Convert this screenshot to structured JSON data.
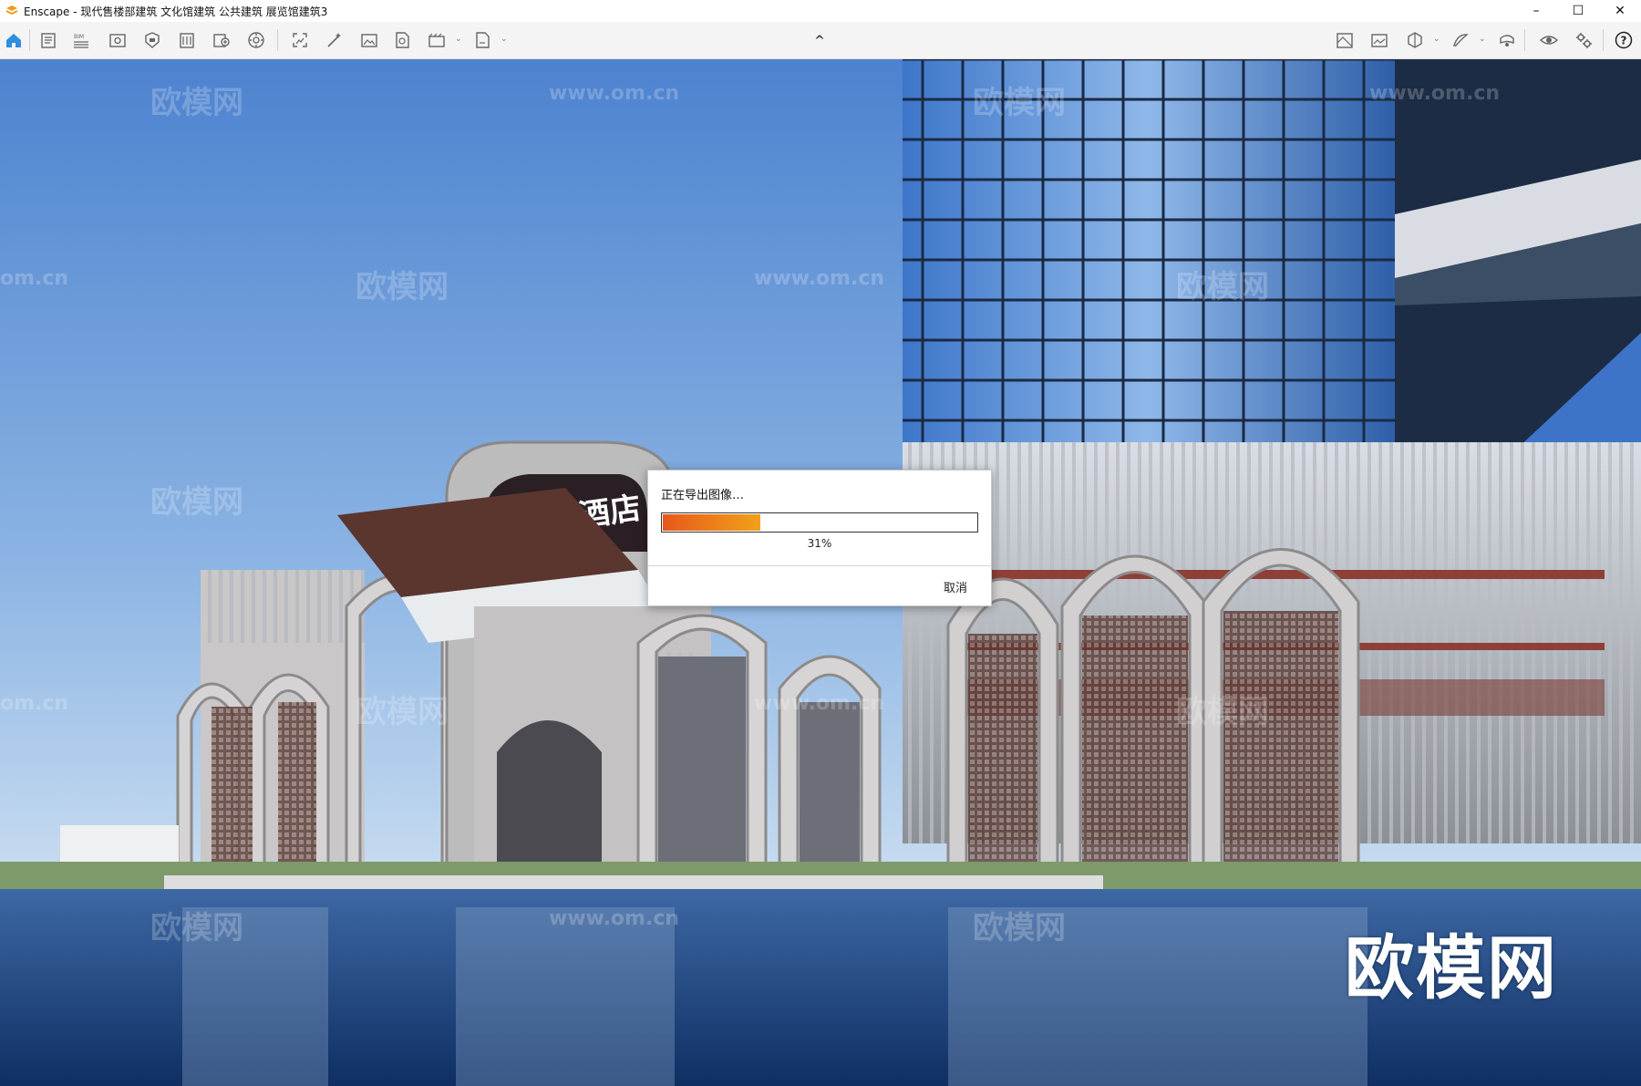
{
  "window": {
    "app_name": "Enscape",
    "title": "Enscape - 现代售楼部建筑 文化馆建筑 公共建筑 展览馆建筑3",
    "controls": [
      "minimize",
      "maximize",
      "close"
    ]
  },
  "toolbar": {
    "left_icons": [
      "home-icon",
      "notes-icon",
      "bim-icon",
      "view-icon",
      "asset-icon",
      "material-icon",
      "library-icon",
      "atmosphere-icon",
      "batch-icon",
      "screenshot-icon",
      "render-icon",
      "panorama-icon",
      "video-icon",
      "export-icon"
    ],
    "right_icons": [
      "map-icon",
      "image-icon",
      "section-icon",
      "sketch-icon",
      "vr-icon",
      "visibility-icon",
      "settings-icon",
      "help-icon"
    ],
    "collapse_caret": "^"
  },
  "viewport": {
    "sign_text": "全世紀酒店",
    "watermark_cn": "欧模网",
    "watermark_url": "www.om.cn",
    "watermark_partial": "om.cn",
    "big_watermark": "欧模网"
  },
  "dialog": {
    "status_text": "正在导出图像…",
    "progress": 0.31,
    "progress_label": "31%",
    "cancel_label": "取消"
  },
  "colors": {
    "progress_start": "#e8581a",
    "progress_end": "#f1a11a",
    "toolbar_accent": "#2f8fe0"
  }
}
